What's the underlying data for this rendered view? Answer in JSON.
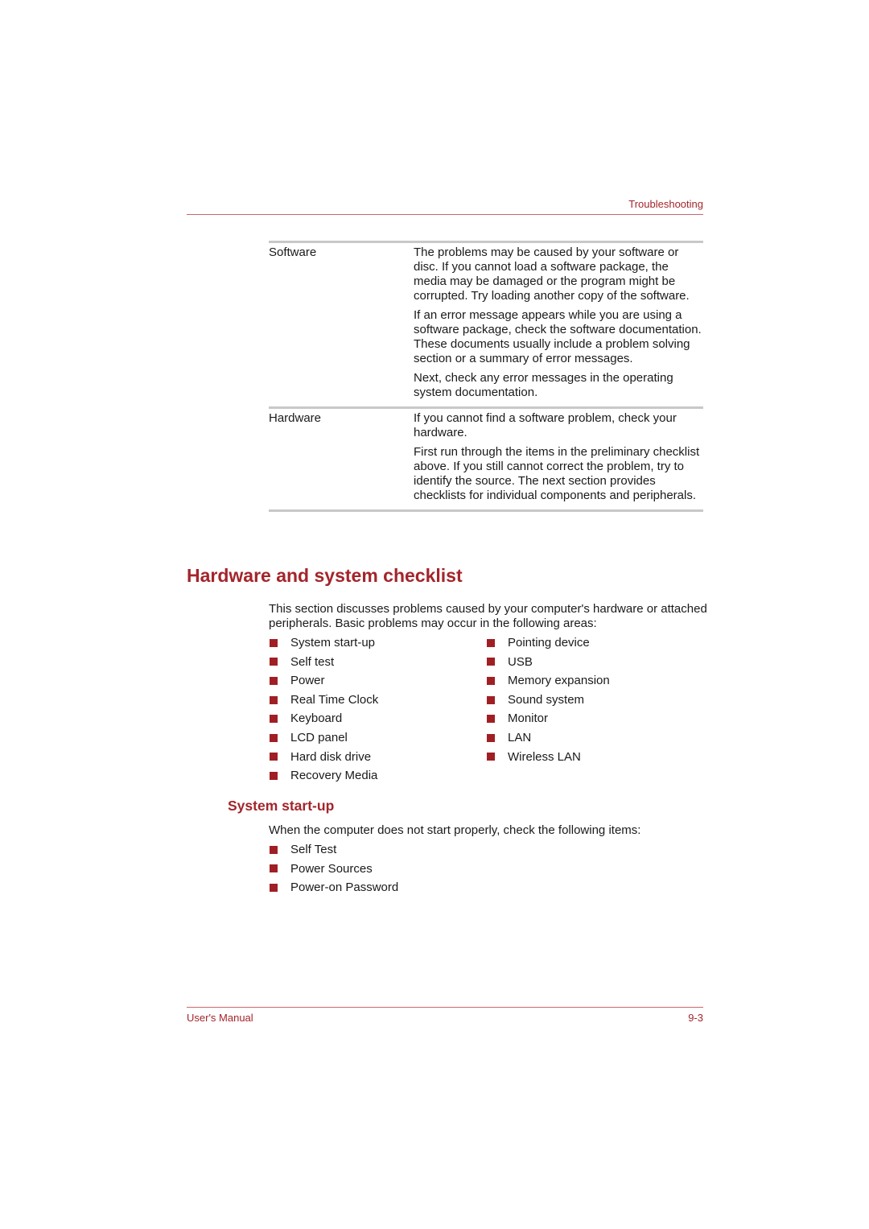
{
  "header": {
    "section": "Troubleshooting"
  },
  "table": {
    "rows": [
      {
        "label": "Software",
        "paragraphs": [
          "The problems may be caused by your software or disc. If you cannot load a software package, the media may be damaged or the program might be corrupted. Try loading another copy of the software.",
          "If an error message appears while you are using a software package, check the software documentation. These documents usually include a problem solving section or a summary of error messages.",
          "Next, check any error messages in the operating system documentation."
        ]
      },
      {
        "label": "Hardware",
        "paragraphs": [
          "If you cannot find a software problem, check your hardware.",
          "First run through the items in the preliminary checklist above. If you still cannot correct the problem, try to identify the source. The next section provides checklists for individual components and peripherals."
        ]
      }
    ]
  },
  "section": {
    "title": "Hardware and system checklist",
    "intro": "This section discusses problems caused by your computer's hardware or attached peripherals. Basic problems may occur in the following areas:",
    "areas_left": [
      "System start-up",
      "Self test",
      "Power",
      "Real Time Clock",
      "Keyboard",
      "LCD panel",
      "Hard disk drive",
      "Recovery Media"
    ],
    "areas_right": [
      "Pointing device",
      "USB",
      "Memory expansion",
      "Sound system",
      "Monitor",
      "LAN",
      "Wireless LAN"
    ]
  },
  "subsection": {
    "title": "System start-up",
    "intro": "When the computer does not start properly, check the following items:",
    "items": [
      "Self Test",
      "Power Sources",
      "Power-on Password"
    ]
  },
  "footer": {
    "manual": "User's Manual",
    "page": "9-3"
  },
  "colors": {
    "accent": "#a3252b",
    "bullet": "#a01f24",
    "rule_gray": "#c8c8c8"
  }
}
